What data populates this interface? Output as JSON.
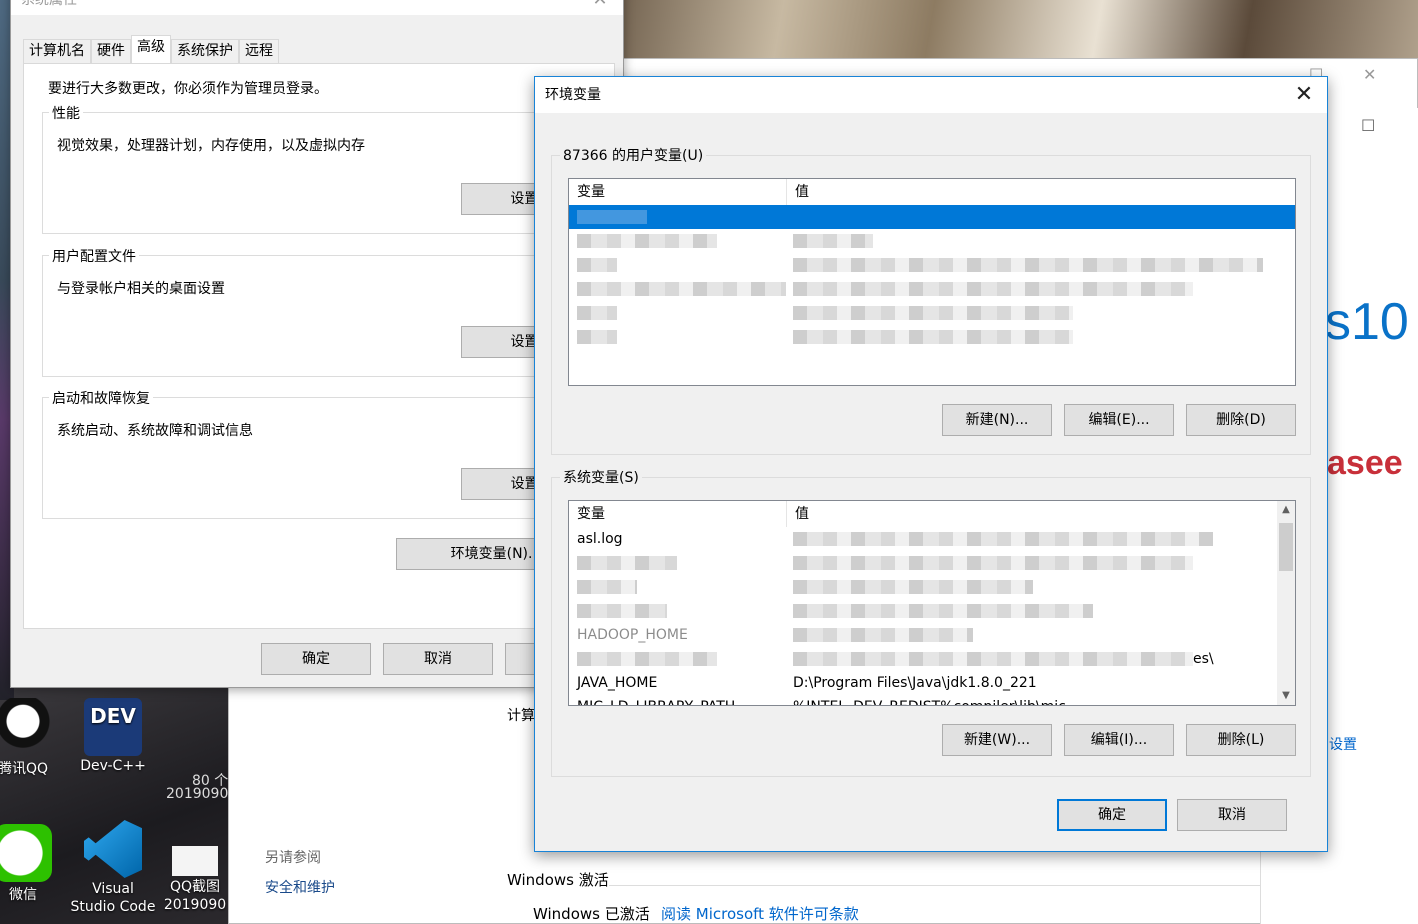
{
  "sysprops": {
    "title": "系统属性",
    "close_icon": "✕",
    "tabs": [
      "计算机名",
      "硬件",
      "高级",
      "系统保护",
      "远程"
    ],
    "active_tab": "高级",
    "admin_note": "要进行大多数更改，你必须作为管理员登录。",
    "groups": [
      {
        "label": "性能",
        "desc": "视觉效果，处理器计划，内存使用，以及虚拟内存",
        "button": "设置(S)..."
      },
      {
        "label": "用户配置文件",
        "desc": "与登录帐户相关的桌面设置",
        "button": "设置(E)..."
      },
      {
        "label": "启动和故障恢复",
        "desc": "系统启动、系统故障和调试信息",
        "button": "设置(T)..."
      }
    ],
    "env_button": "环境变量(N)...",
    "ok": "确定",
    "cancel": "取消"
  },
  "envvars": {
    "title": "环境变量",
    "close_icon": "✕",
    "user_group": "87366 的用户变量(U)",
    "col_var": "变量",
    "col_val": "值",
    "user_buttons": [
      "新建(N)...",
      "编辑(E)...",
      "删除(D)"
    ],
    "system_group": "系统变量(S)",
    "system_rows": [
      {
        "var": "asl.log",
        "val": ""
      },
      {
        "var": "",
        "val": ""
      },
      {
        "var": "",
        "val": ""
      },
      {
        "var": "",
        "val": ""
      },
      {
        "var": "HADOOP_HOME",
        "val": ""
      },
      {
        "var": "",
        "val": "es\\"
      },
      {
        "var": "JAVA_HOME",
        "val": "D:\\Program Files\\Java\\jdk1.8.0_221"
      },
      {
        "var": "MIC_LD_LIBRARY_PATH",
        "val": "%INTEL_DEV_REDIST%compiler\\lib\\mic"
      }
    ],
    "system_buttons": [
      "新建(W)...",
      "编辑(I)...",
      "删除(L)"
    ],
    "ok": "确定",
    "cancel": "取消"
  },
  "background_window": {
    "computer_label": "计算",
    "see_also": "另请参阅",
    "security_link": "安全和维护",
    "activation_heading": "Windows 激活",
    "activated_text": "Windows 已激活",
    "license_link": "阅读 Microsoft 软件许可条款",
    "settings_link": "设置",
    "win10_logo": "s10",
    "csdn_logo": "asee",
    "count_text": "80 个",
    "date_text": "2019090"
  },
  "desktop_icons": [
    {
      "label": "腾讯QQ",
      "icon": "qq-icon"
    },
    {
      "label": "Dev-C++",
      "icon": "devcpp-icon"
    },
    {
      "label": "微信",
      "icon": "wechat-icon"
    },
    {
      "label": "Visual Studio Code",
      "icon": "vscode-icon"
    },
    {
      "label": "QQ截图 2019090",
      "icon": "screenshot-file-icon"
    }
  ]
}
